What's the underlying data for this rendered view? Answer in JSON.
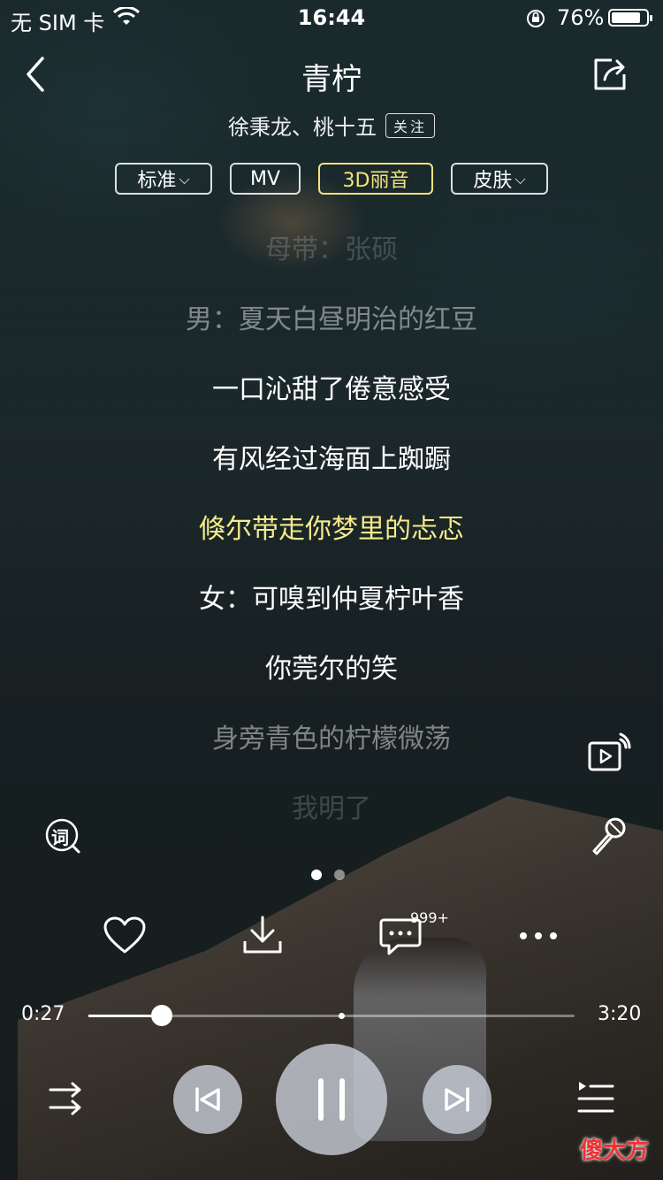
{
  "status_bar": {
    "carrier": "无 SIM 卡",
    "time": "16:44",
    "battery_percent": "76%",
    "battery_level": 0.76
  },
  "header": {
    "title": "青柠",
    "artist": "徐秉龙、桃十五",
    "follow_label": "关注"
  },
  "chips": {
    "quality": "标准",
    "mv": "MV",
    "sound": "3D丽音",
    "skin": "皮肤"
  },
  "lyrics": [
    "母带：张硕",
    "男：夏天白昼明治的红豆",
    "一口沁甜了倦意感受",
    "有风经过海面上踟蹰",
    "倏尔带走你梦里的忐忑",
    "女：可嗅到仲夏柠叶香",
    "你莞尔的笑",
    "身旁青色的柠檬微荡",
    "我明了"
  ],
  "active_lyric_index": 4,
  "side": {
    "lyric_icon_char": "词"
  },
  "pager": {
    "count": 2,
    "active": 0
  },
  "actions": {
    "comment_count": "999+"
  },
  "progress": {
    "current": "0:27",
    "total": "3:20",
    "played_fraction": 0.15,
    "buffered_fraction": 0.52
  },
  "watermark": "傻大方",
  "colors": {
    "accent": "#f6ea8c",
    "control_bg": "#cdd2dc"
  }
}
